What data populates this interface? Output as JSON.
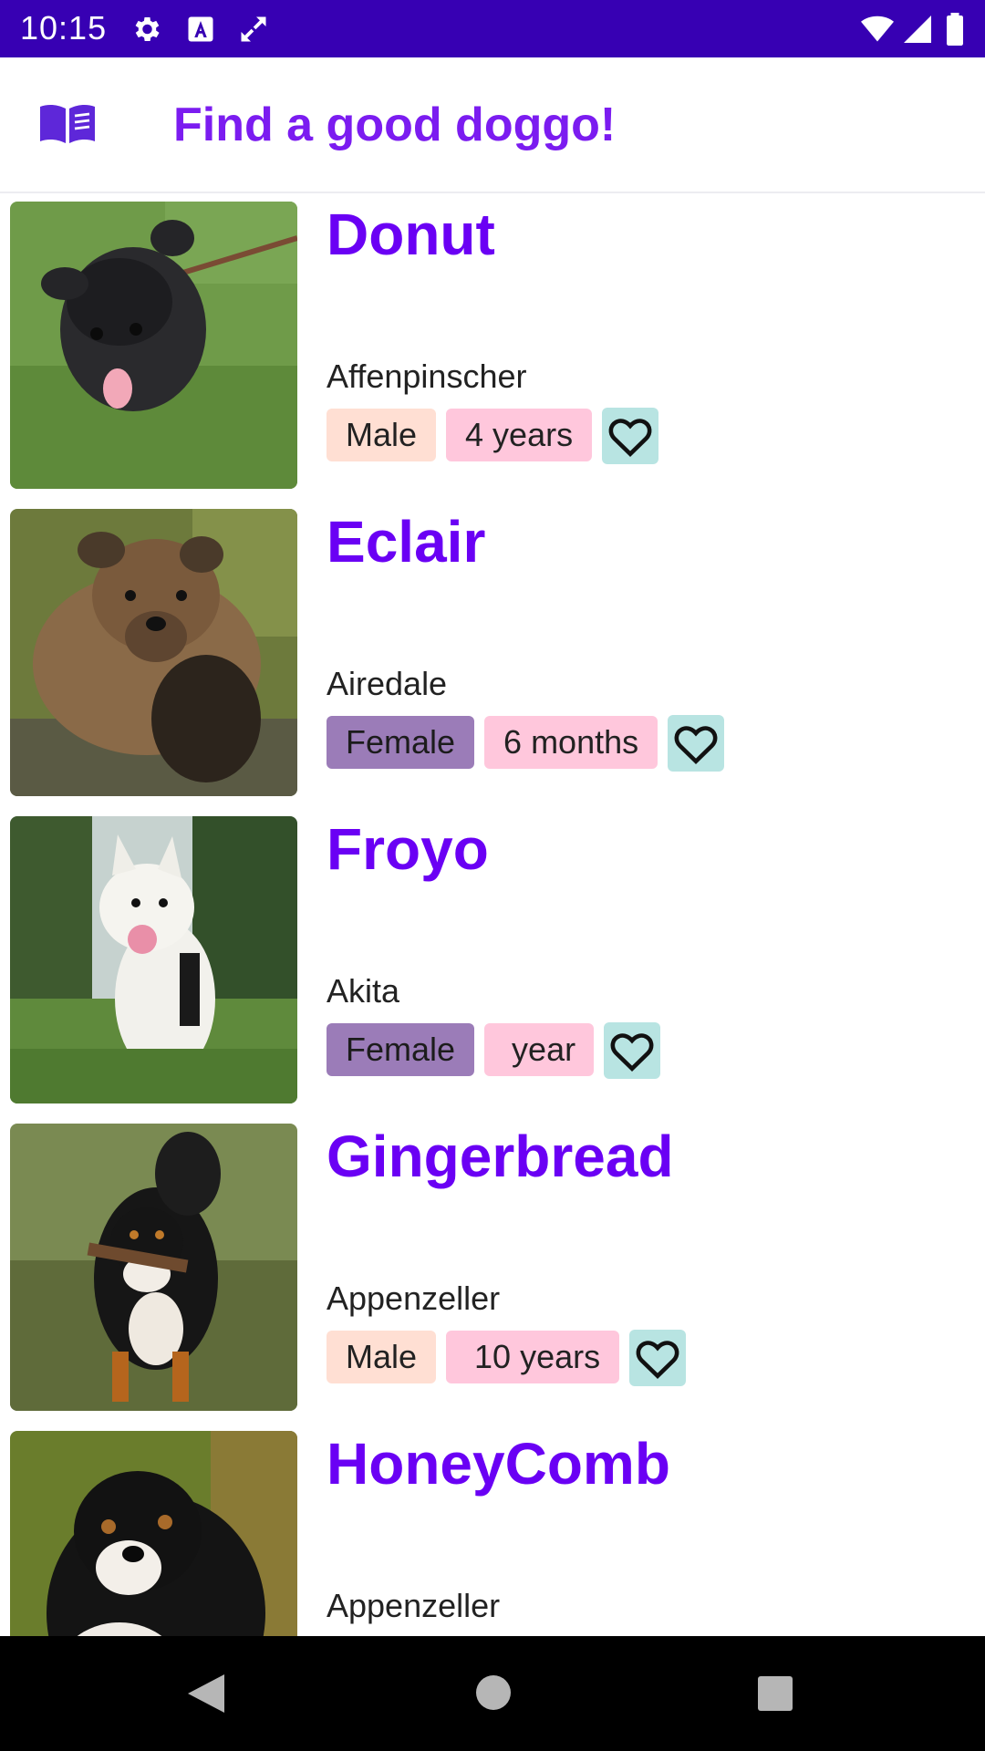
{
  "status_bar": {
    "time": "10:15"
  },
  "app_bar": {
    "title": "Find a good doggo!"
  },
  "dogs": [
    {
      "name": "Donut",
      "breed": "Affenpinscher",
      "gender": "Male",
      "age": "4 years"
    },
    {
      "name": "Eclair",
      "breed": "Airedale",
      "gender": "Female",
      "age": "6 months"
    },
    {
      "name": "Froyo",
      "breed": "Akita",
      "gender": "Female",
      "age": "year"
    },
    {
      "name": "Gingerbread",
      "breed": "Appenzeller",
      "gender": "Male",
      "age": "10 years"
    },
    {
      "name": "HoneyComb",
      "breed": "Appenzeller"
    }
  ],
  "icons": {
    "status": [
      "settings-icon",
      "a-icon",
      "rotate-icon",
      "wifi-icon",
      "signal-icon",
      "battery-icon"
    ],
    "app_bar": "book-icon",
    "favorite": "heart-outline-icon",
    "nav": [
      "back-icon",
      "home-icon",
      "recents-icon"
    ]
  },
  "colors": {
    "status_bar": "#3700b3",
    "title": "#7b1cf0",
    "name": "#6a00f4",
    "chip_male": "#ffdfd3",
    "chip_female": "#9b7cb8",
    "chip_age": "#ffc7dc",
    "favorite": "#b8e4e2"
  }
}
